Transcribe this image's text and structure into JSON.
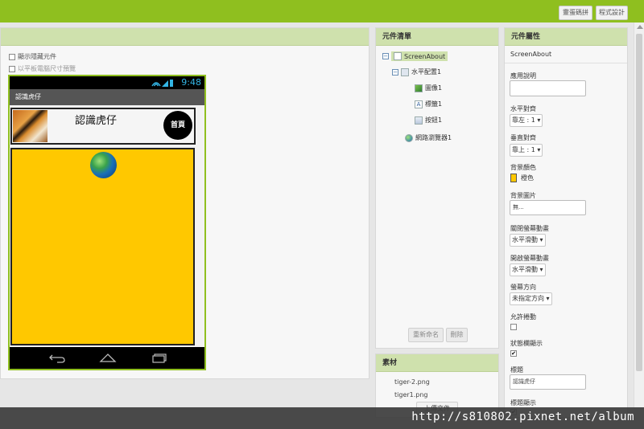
{
  "toolbar": {
    "emulator_button": "靈蛋碼拼",
    "designer_button": "程式設計"
  },
  "viewer": {
    "show_hidden_label": "顯示隱藏元件",
    "tablet_preview_label": "以平板電腦尺寸預覽",
    "phone": {
      "clock": "9:48",
      "screen_title": "認識虎仔",
      "label_text": "認識虎仔",
      "home_button_text": "首頁",
      "webview_color": "#ffc800"
    }
  },
  "components": {
    "title": "元件清單",
    "tree": [
      {
        "label": "ScreenAbout",
        "toggle": "⊟",
        "icon": "screen-icon",
        "selected": true
      },
      {
        "label": "水平配置1",
        "toggle": "⊟",
        "icon": "horizontal-arrangement-icon"
      },
      {
        "label": "圖像1",
        "icon": "image-icon"
      },
      {
        "label": "標籤1",
        "icon": "label-icon"
      },
      {
        "label": "按鈕1",
        "icon": "button-icon"
      },
      {
        "label": "網路瀏覽器1",
        "icon": "webviewer-icon"
      }
    ],
    "rename_button": "重新命名",
    "delete_button": "刪除"
  },
  "media": {
    "title": "素材",
    "files": [
      "tiger-2.png",
      "tiger1.png"
    ],
    "upload_button": "上傳文件"
  },
  "properties": {
    "title": "元件屬性",
    "component": "ScreenAbout",
    "about_label": "應用說明",
    "halign_label": "水平對齊",
    "halign_value": "靠左 : 1",
    "valign_label": "垂直對齊",
    "valign_value": "靠上 : 1",
    "bgcolor_label": "背景顏色",
    "bgcolor_value": "橙色",
    "bgcolor_swatch": "#ffc800",
    "bgimage_label": "背景圖片",
    "bgimage_value": "無...",
    "close_anim_label": "關閉螢幕動畫",
    "close_anim_value": "水平滑動",
    "open_anim_label": "開啟螢幕動畫",
    "open_anim_value": "水平滑動",
    "orientation_label": "螢幕方向",
    "orientation_value": "未指定方向",
    "scrollable_label": "允許捲動",
    "scrollable_checked": false,
    "statusbar_label": "狀態欄顯示",
    "statusbar_checked": true,
    "title_prop_label": "標題",
    "title_prop_value": "認識虎仔",
    "title_visible_label": "標題顯示",
    "title_visible_checked": true
  },
  "watermark": "http://s810802.pixnet.net/album"
}
